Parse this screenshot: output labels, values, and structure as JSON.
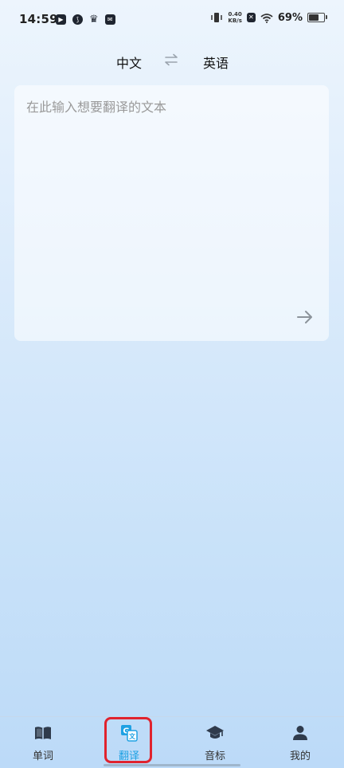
{
  "status_bar": {
    "time": "14:59",
    "net_speed_value": "0.40",
    "net_speed_unit": "KB/s",
    "battery_text": "69%",
    "battery_level": 0.69,
    "left_icons": [
      "play-box-icon",
      "swoosh-icon",
      "crown-icon",
      "inbox-icon"
    ],
    "right_icons": [
      "vibrate-icon",
      "sim-x-icon",
      "wifi-icon",
      "battery-icon"
    ]
  },
  "language_bar": {
    "source": "中文",
    "target": "英语",
    "swap_icon": "swap-arrows-icon"
  },
  "translate_input": {
    "placeholder": "在此输入想要翻译的文本",
    "value": "",
    "submit_icon": "arrow-right-icon"
  },
  "bottom_nav": {
    "items": [
      {
        "label": "单词",
        "icon": "book-icon",
        "active": false
      },
      {
        "label": "翻译",
        "icon": "translate-icon",
        "active": true
      },
      {
        "label": "音标",
        "icon": "graduation-cap-icon",
        "active": false
      },
      {
        "label": "我的",
        "icon": "user-icon",
        "active": false
      }
    ]
  },
  "colors": {
    "accent": "#1fa1e3",
    "highlight": "#e0232e",
    "text": "#111111",
    "placeholder": "#9a9a9a"
  }
}
